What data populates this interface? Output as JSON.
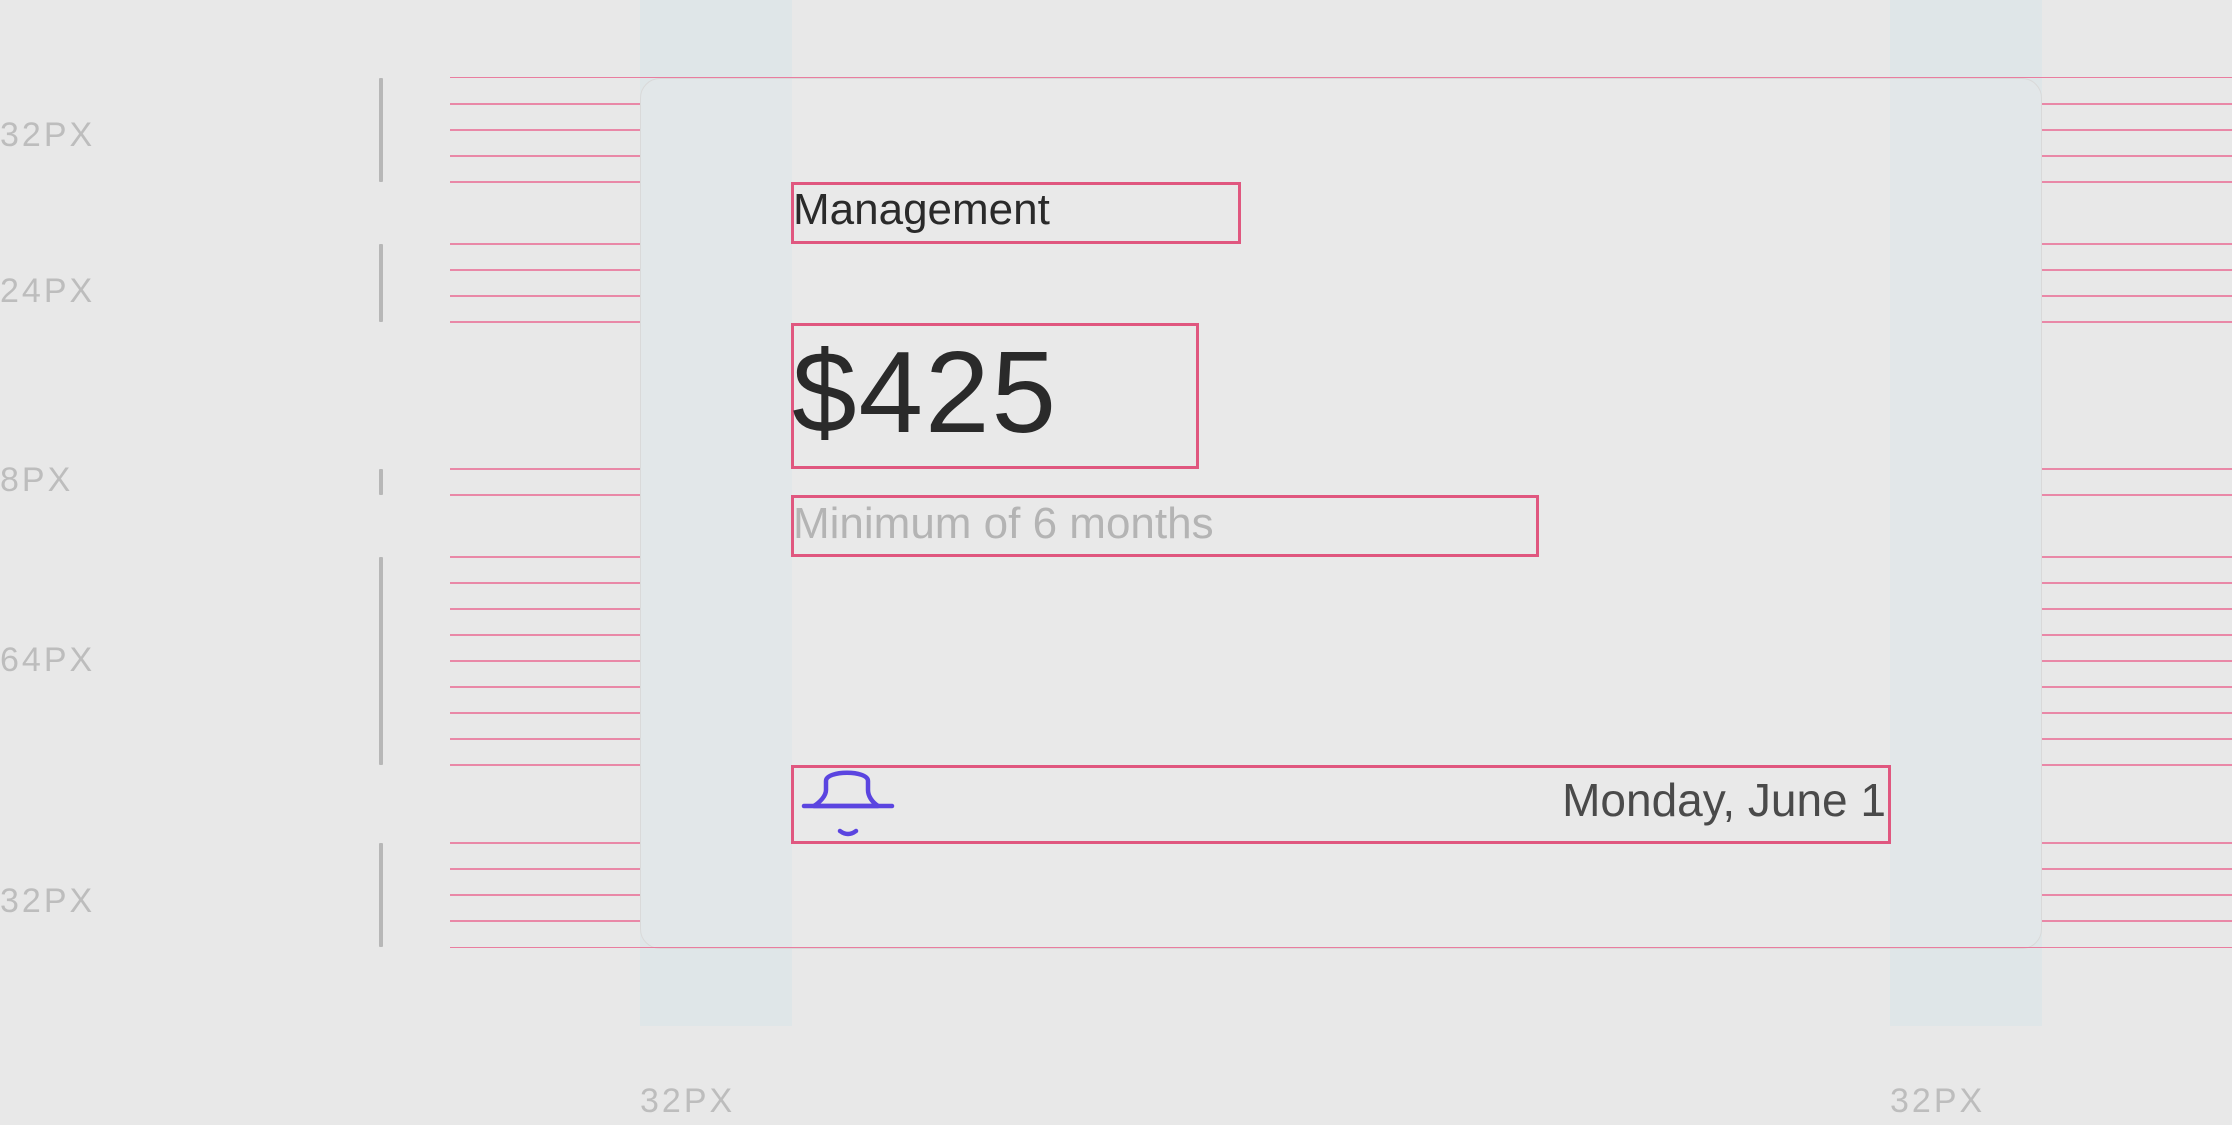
{
  "spacing_labels": {
    "top_padding": "32PX",
    "title_gap": "24PX",
    "subtitle_gap": "8PX",
    "footer_gap": "64PX",
    "bottom_padding": "32PX",
    "left_padding": "32PX",
    "right_padding": "32PX"
  },
  "card": {
    "title": "Management",
    "price": "$425",
    "subtitle": "Minimum of 6 months",
    "footer": {
      "icon": "bell-icon",
      "date": "Monday, June 1"
    }
  },
  "colors": {
    "background": "#e8e8e8",
    "column_shade": "#dfe6e8",
    "grid_line": "#e9779b",
    "outline": "#e0577f",
    "icon_accent": "#5b45e0",
    "label_gray": "#bdbdbd"
  }
}
